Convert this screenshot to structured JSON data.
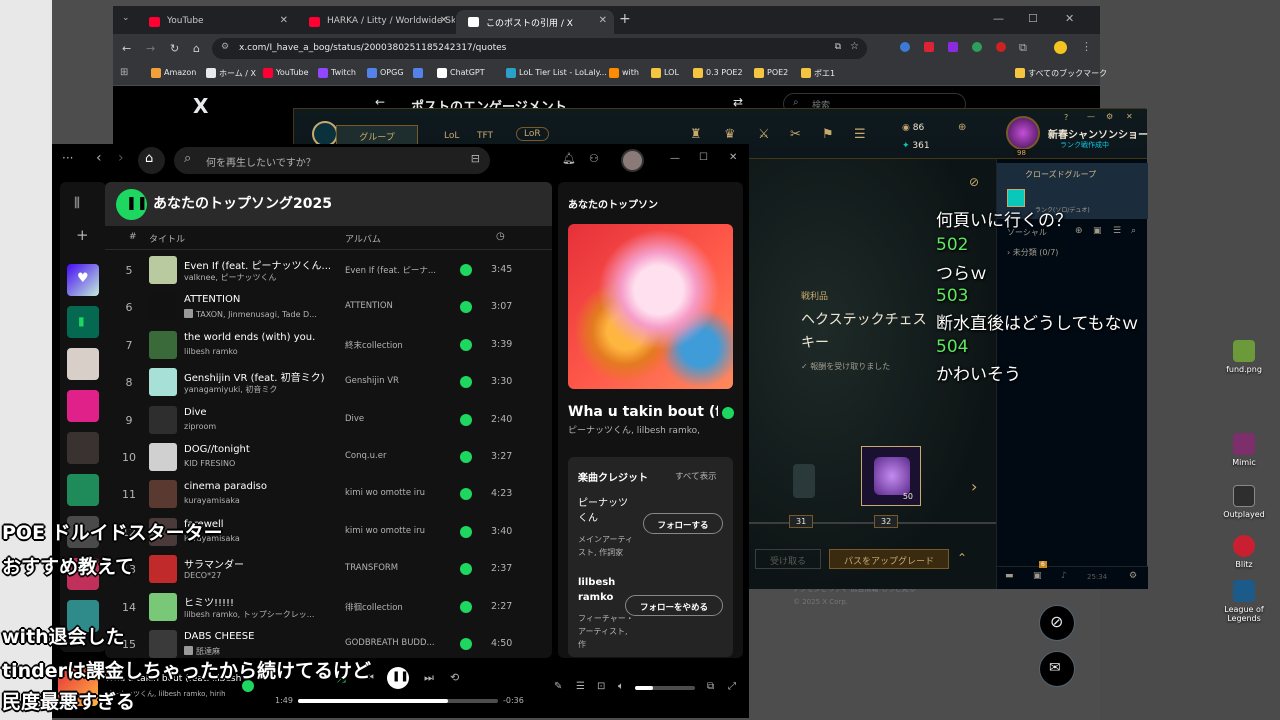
{
  "desktop": {
    "icons": [
      {
        "label": "fund.png",
        "color": "#6c9a3a"
      },
      {
        "label": "Mimic",
        "color": "#7c2f6a"
      },
      {
        "label": "Outplayed",
        "color": "#2e2e2e"
      },
      {
        "label": "Blitz",
        "color": "#c82030"
      },
      {
        "label": "League of Legends",
        "color": "#1c5a8a"
      }
    ]
  },
  "chrome": {
    "tabs": [
      {
        "label": "YouTube",
        "fav_color": "#ff0033"
      },
      {
        "label": "HARKA / Litty / Worldwide Skip",
        "fav_color": "#ff0033"
      },
      {
        "label": "このポストの引用 / X",
        "fav_color": "#ffffff"
      }
    ],
    "new_tab": "+",
    "url": "x.com/I_have_a_bog/status/2000380251185242317/quotes",
    "bookmarks": [
      "Amazon",
      "ホーム / X",
      "YouTube",
      "Twitch",
      "OPGG",
      "",
      "ChatGPT",
      "LoL Tier List - LoLaly...",
      "with",
      "LOL",
      "0.3 POE2",
      "POE2",
      "ポエ1"
    ],
    "bookmark_colors": [
      "#f2a13a",
      "#e7e9ea",
      "#ff0033",
      "#9146ff",
      "#5383e8",
      "#5383e8",
      "#ffffff",
      "#2aa1c8",
      "#ff8c00",
      "#f5c542",
      "#f5c542",
      "#f5c542",
      "#f5c542"
    ],
    "all_bookmarks": "すべてのブックマーク"
  },
  "x": {
    "logo": "X",
    "title": "ポストのエンゲージメント",
    "search_placeholder": "検索",
    "footer_line1": "アクセシビリティ  広告情報  もっと見る",
    "footer_line2": "© 2025 X Corp."
  },
  "lol": {
    "tabs": [
      "グループ",
      "LoL",
      "TFT",
      "LoR"
    ],
    "currency_rp": "86",
    "currency_be": "361",
    "profile_level": "98",
    "profile_name": "新春シャンソンショー",
    "profile_status": "ランク戦作成中",
    "social_group": "クローズドグループ",
    "social_rank": "ランク(ソロ/デュオ)",
    "social_label": "ソーシャル",
    "social_folder": "未分類 (0/7)",
    "reward_label": "戦利品",
    "reward_title": "ヘクステックチェス",
    "reward_title2": "キー",
    "reward_status": "報酬を受け取りました",
    "reward_count": "50",
    "track_left": "31",
    "track_right": "32",
    "btn_claim": "受け取る",
    "btn_upgrade": "パスをアップグレード",
    "bottom_time": "25:34",
    "bottom_badge": "6"
  },
  "chat_overlay": [
    {
      "text": "何頁いに行くの？",
      "num": false
    },
    {
      "text": "502",
      "num": true
    },
    {
      "text": "つらｗ",
      "num": false
    },
    {
      "text": "503",
      "num": true
    },
    {
      "text": "断水直後はどうしてもなｗ",
      "num": false
    },
    {
      "text": "504",
      "num": true
    },
    {
      "text": "かわいそう",
      "num": false
    }
  ],
  "spotify": {
    "search_placeholder": "何を再生したいですか？",
    "playlist_title": "あなたのトップソング2025",
    "columns": {
      "num": "#",
      "title": "タイトル",
      "album": "アルバム"
    },
    "tracks": [
      {
        "num": "5",
        "title": "Even If (feat. ピーナッツくん...",
        "artist": "valknee, ピーナッツくん",
        "album": "Even If (feat. ピーナ...",
        "dur": "3:45",
        "explicit": false,
        "art": "#b9c9a0"
      },
      {
        "num": "6",
        "title": "ATTENTION",
        "artist": "TAXON, Jinmenusagi, Tade D...",
        "album": "ATTENTION",
        "dur": "3:07",
        "explicit": true,
        "art": "#111111"
      },
      {
        "num": "7",
        "title": "the world ends (with) you.",
        "artist": "lilbesh ramko",
        "album": "終末collection",
        "dur": "3:39",
        "explicit": false,
        "art": "#3a6a3a"
      },
      {
        "num": "8",
        "title": "Genshijin VR (feat. 初音ミク)",
        "artist": "yanagamiyuki, 初音ミク",
        "album": "Genshijin VR",
        "dur": "3:30",
        "explicit": false,
        "art": "#a6e0d6"
      },
      {
        "num": "9",
        "title": "Dive",
        "artist": "ziproom",
        "album": "Dive",
        "dur": "2:40",
        "explicit": false,
        "art": "#2e2e2e"
      },
      {
        "num": "10",
        "title": "DOG//tonight",
        "artist": "KID FRESINO",
        "album": "Conq.u.er",
        "dur": "3:27",
        "explicit": false,
        "art": "#d0d0d0"
      },
      {
        "num": "11",
        "title": "cinema paradiso",
        "artist": "kurayamisaka",
        "album": "kimi wo omotte iru",
        "dur": "4:23",
        "explicit": false,
        "art": "#5a3a30"
      },
      {
        "num": "12",
        "title": "farewell",
        "artist": "kurayamisaka",
        "album": "kimi wo omotte iru",
        "dur": "3:40",
        "explicit": false,
        "art": "#4a3a3a"
      },
      {
        "num": "13",
        "title": "サラマンダー",
        "artist": "DECO*27",
        "album": "TRANSFORM",
        "dur": "2:37",
        "explicit": false,
        "art": "#c02a2a"
      },
      {
        "num": "14",
        "title": "ヒミツ!!!!!",
        "artist": "lilbesh ramko, トップシークレッ...",
        "album": "徘徊collection",
        "dur": "2:27",
        "explicit": false,
        "art": "#78c878"
      },
      {
        "num": "15",
        "title": "DABS CHEESE",
        "artist": "舐達麻",
        "album": "GODBREATH BUDD...",
        "dur": "4:50",
        "explicit": true,
        "art": "#3a3a3a"
      }
    ],
    "right_header": "あなたのトップソン",
    "now_title": "Wha u takin bout (fe",
    "now_artist": "ピーナッツくん, lilbesh ramko,",
    "credits_title": "楽曲クレジット",
    "credits_all": "すべて表示",
    "credit1_name": "ピーナッツ くん",
    "credit1_role": "メインアーティスト, 作詞家",
    "credit1_btn": "フォローする",
    "credit2_name": "lilbesh ramko",
    "credit2_role": "フィーチャー・アーティスト, 作",
    "credit2_btn": "フォローをやめる",
    "player": {
      "title": "Wha u takin bout (feat. lilbesh",
      "artist": "ピーナッツくん, lilbesh ramko, hirih",
      "elapsed": "1:49",
      "remaining": "-0:36",
      "progress": 0.75,
      "volume": 0.3
    }
  },
  "subtitles": [
    "POE ドルイドスターター",
    "おすすめ教えて",
    "with退会した",
    "tinderは課金しちゃったから続けてるけど",
    "民度最悪すぎる"
  ]
}
